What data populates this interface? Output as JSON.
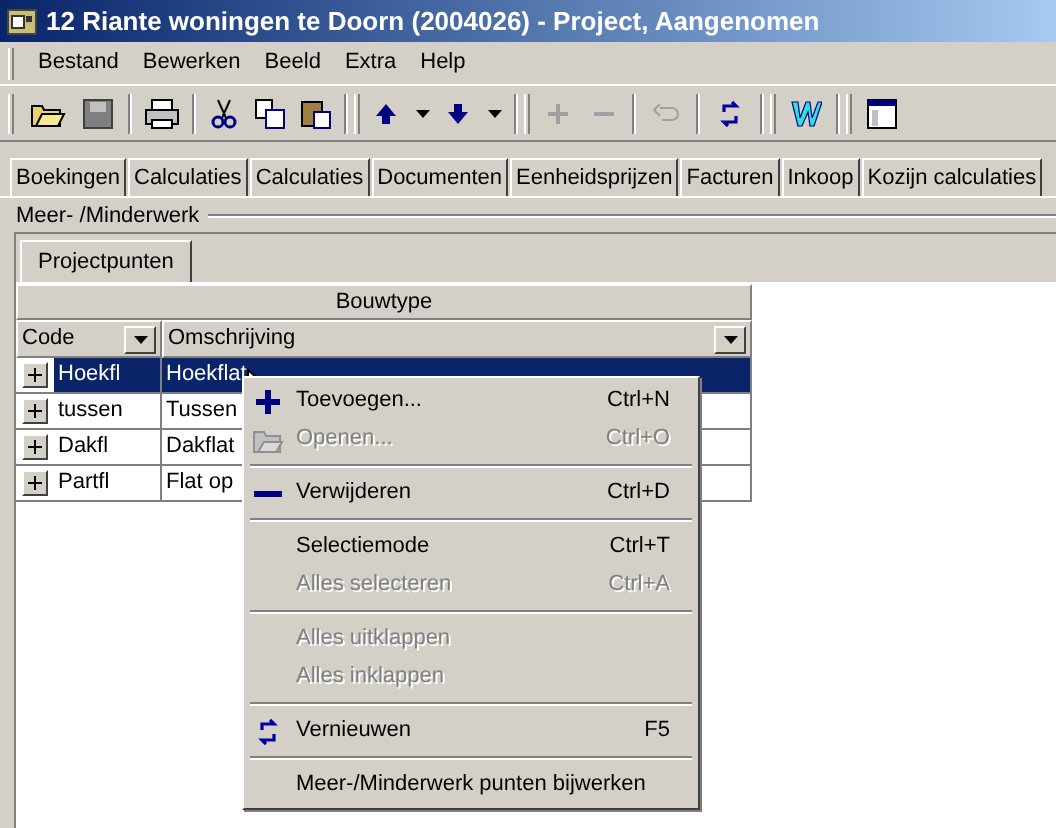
{
  "window": {
    "title": "12 Riante woningen te Doorn (2004026) - Project, Aangenomen"
  },
  "menu_bar": [
    "Bestand",
    "Bewerken",
    "Beeld",
    "Extra",
    "Help"
  ],
  "tabs": [
    {
      "label": "Boekingen",
      "selected": false
    },
    {
      "label": "Calculaties",
      "selected": false
    },
    {
      "label": "Calculaties",
      "selected": false
    },
    {
      "label": "Documenten",
      "selected": false
    },
    {
      "label": "Eenheidsprijzen",
      "selected": false
    },
    {
      "label": "Facturen",
      "selected": false
    },
    {
      "label": "Inkoop",
      "selected": false
    },
    {
      "label": "Kozijn calculaties",
      "selected": false
    }
  ],
  "group": {
    "title": "Meer- /Minderwerk",
    "tabs": [
      {
        "label": "Projectpunten",
        "selected": true
      }
    ]
  },
  "table": {
    "band": "Bouwtype",
    "columns": [
      "Code",
      "Omschrijving"
    ],
    "rows": [
      {
        "cells": [
          "Hoekfl",
          "Hoekflat"
        ],
        "selected": true,
        "expanded": false
      },
      {
        "cells": [
          "tussen",
          "Tussen"
        ],
        "selected": false,
        "expanded": false
      },
      {
        "cells": [
          "Dakfl",
          "Dakflat"
        ],
        "selected": false,
        "expanded": false
      },
      {
        "cells": [
          "Partfl",
          "Flat op"
        ],
        "selected": false,
        "expanded": false
      }
    ]
  },
  "context_menu": [
    {
      "kind": "item",
      "label": "Toevoegen...",
      "shortcut": "Ctrl+N",
      "disabled": false
    },
    {
      "kind": "item",
      "label": "Openen...",
      "shortcut": "Ctrl+O",
      "disabled": true
    },
    {
      "kind": "separator"
    },
    {
      "kind": "item",
      "label": "Verwijderen",
      "shortcut": "Ctrl+D",
      "disabled": false
    },
    {
      "kind": "separator"
    },
    {
      "kind": "item",
      "label": "Selectiemode",
      "shortcut": "Ctrl+T",
      "disabled": false
    },
    {
      "kind": "item",
      "label": "Alles selecteren",
      "shortcut": "Ctrl+A",
      "disabled": true
    },
    {
      "kind": "separator"
    },
    {
      "kind": "item",
      "label": "Alles uitklappen",
      "disabled": true
    },
    {
      "kind": "item",
      "label": "Alles inklappen",
      "disabled": true
    },
    {
      "kind": "separator"
    },
    {
      "kind": "item",
      "label": "Vernieuwen",
      "shortcut": "F5",
      "disabled": false
    },
    {
      "kind": "separator"
    },
    {
      "kind": "item",
      "label": "Meer-/Minderwerk punten bijwerken",
      "disabled": false
    }
  ]
}
